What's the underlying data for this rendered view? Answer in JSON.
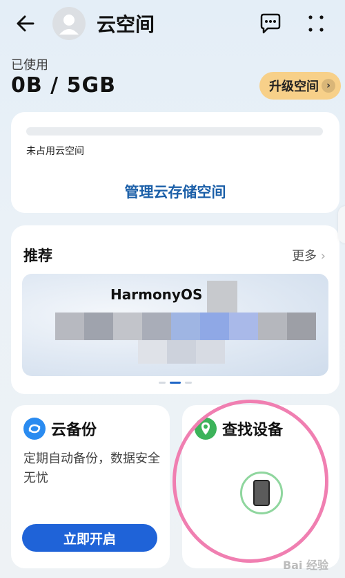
{
  "header": {
    "title": "云空间",
    "back_icon": "back-arrow-icon",
    "chat_icon": "chat-bubble-icon",
    "more_icon": "more-dots-icon"
  },
  "storage_summary": {
    "used_label": "已使用",
    "used_value": "0B / 5GB",
    "upgrade_label": "升级空间"
  },
  "storage_card": {
    "unused_label": "未占用云空间",
    "manage_label": "管理云存储空间",
    "used_fraction": 0
  },
  "recommend": {
    "title": "推荐",
    "more_label": "更多",
    "banner_text": "HarmonyOS",
    "page_count": 3,
    "active_page": 2
  },
  "backup": {
    "title": "云备份",
    "description": "定期自动备份，数据安全无忧",
    "button_label": "立即开启"
  },
  "find_device": {
    "title": "查找设备"
  },
  "watermark": "Bai 经验",
  "colors": {
    "accent_blue": "#1f63d8",
    "link_blue": "#1b5fa8",
    "upgrade_bg": "#f7d089",
    "find_green": "#3cb35a",
    "annotation_pink": "#f07fb1"
  }
}
